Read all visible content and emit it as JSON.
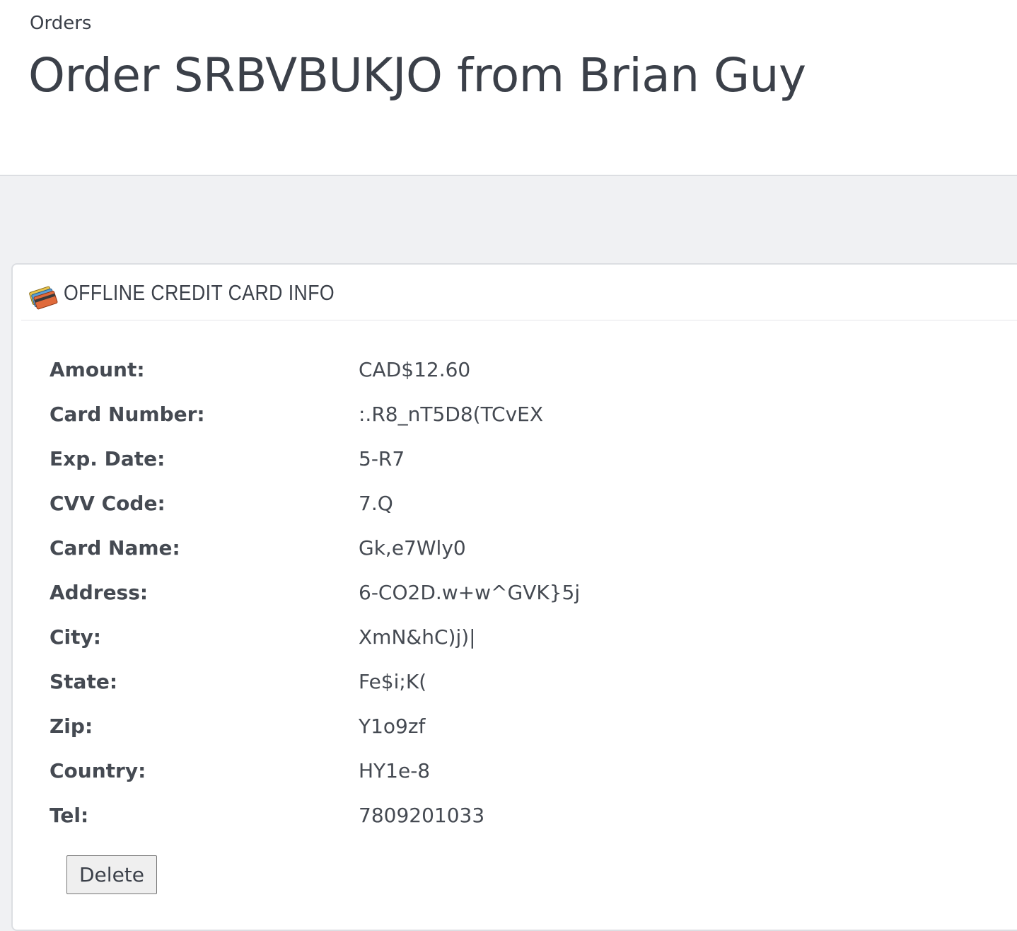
{
  "breadcrumb": "Orders",
  "page_title": "Order SRBVBUKJO from Brian Guy",
  "panel": {
    "title": "OFFLINE CREDIT CARD INFO",
    "icon": "credit-cards-icon"
  },
  "fields": [
    {
      "label": "Amount:",
      "value": "CAD$12.60"
    },
    {
      "label": "Card Number:",
      "value": ":.R8_nT5D8(TCvEX"
    },
    {
      "label": "Exp. Date:",
      "value": "5-R7"
    },
    {
      "label": "CVV Code:",
      "value": "7.Q"
    },
    {
      "label": "Card Name:",
      "value": "Gk,e7Wly0"
    },
    {
      "label": "Address:",
      "value": "6-CO2D.w+w^GVK}5j"
    },
    {
      "label": "City:",
      "value": "XmN&hC)j)|"
    },
    {
      "label": "State:",
      "value": "Fe$i;K("
    },
    {
      "label": "Zip:",
      "value": "Y1o9zf"
    },
    {
      "label": "Country:",
      "value": "HY1e-8"
    },
    {
      "label": "Tel:",
      "value": "7809201033"
    }
  ],
  "delete_label": "Delete",
  "colors": {
    "background": "#f0f1f3",
    "text": "#3b4049",
    "border": "#dcdee2"
  }
}
